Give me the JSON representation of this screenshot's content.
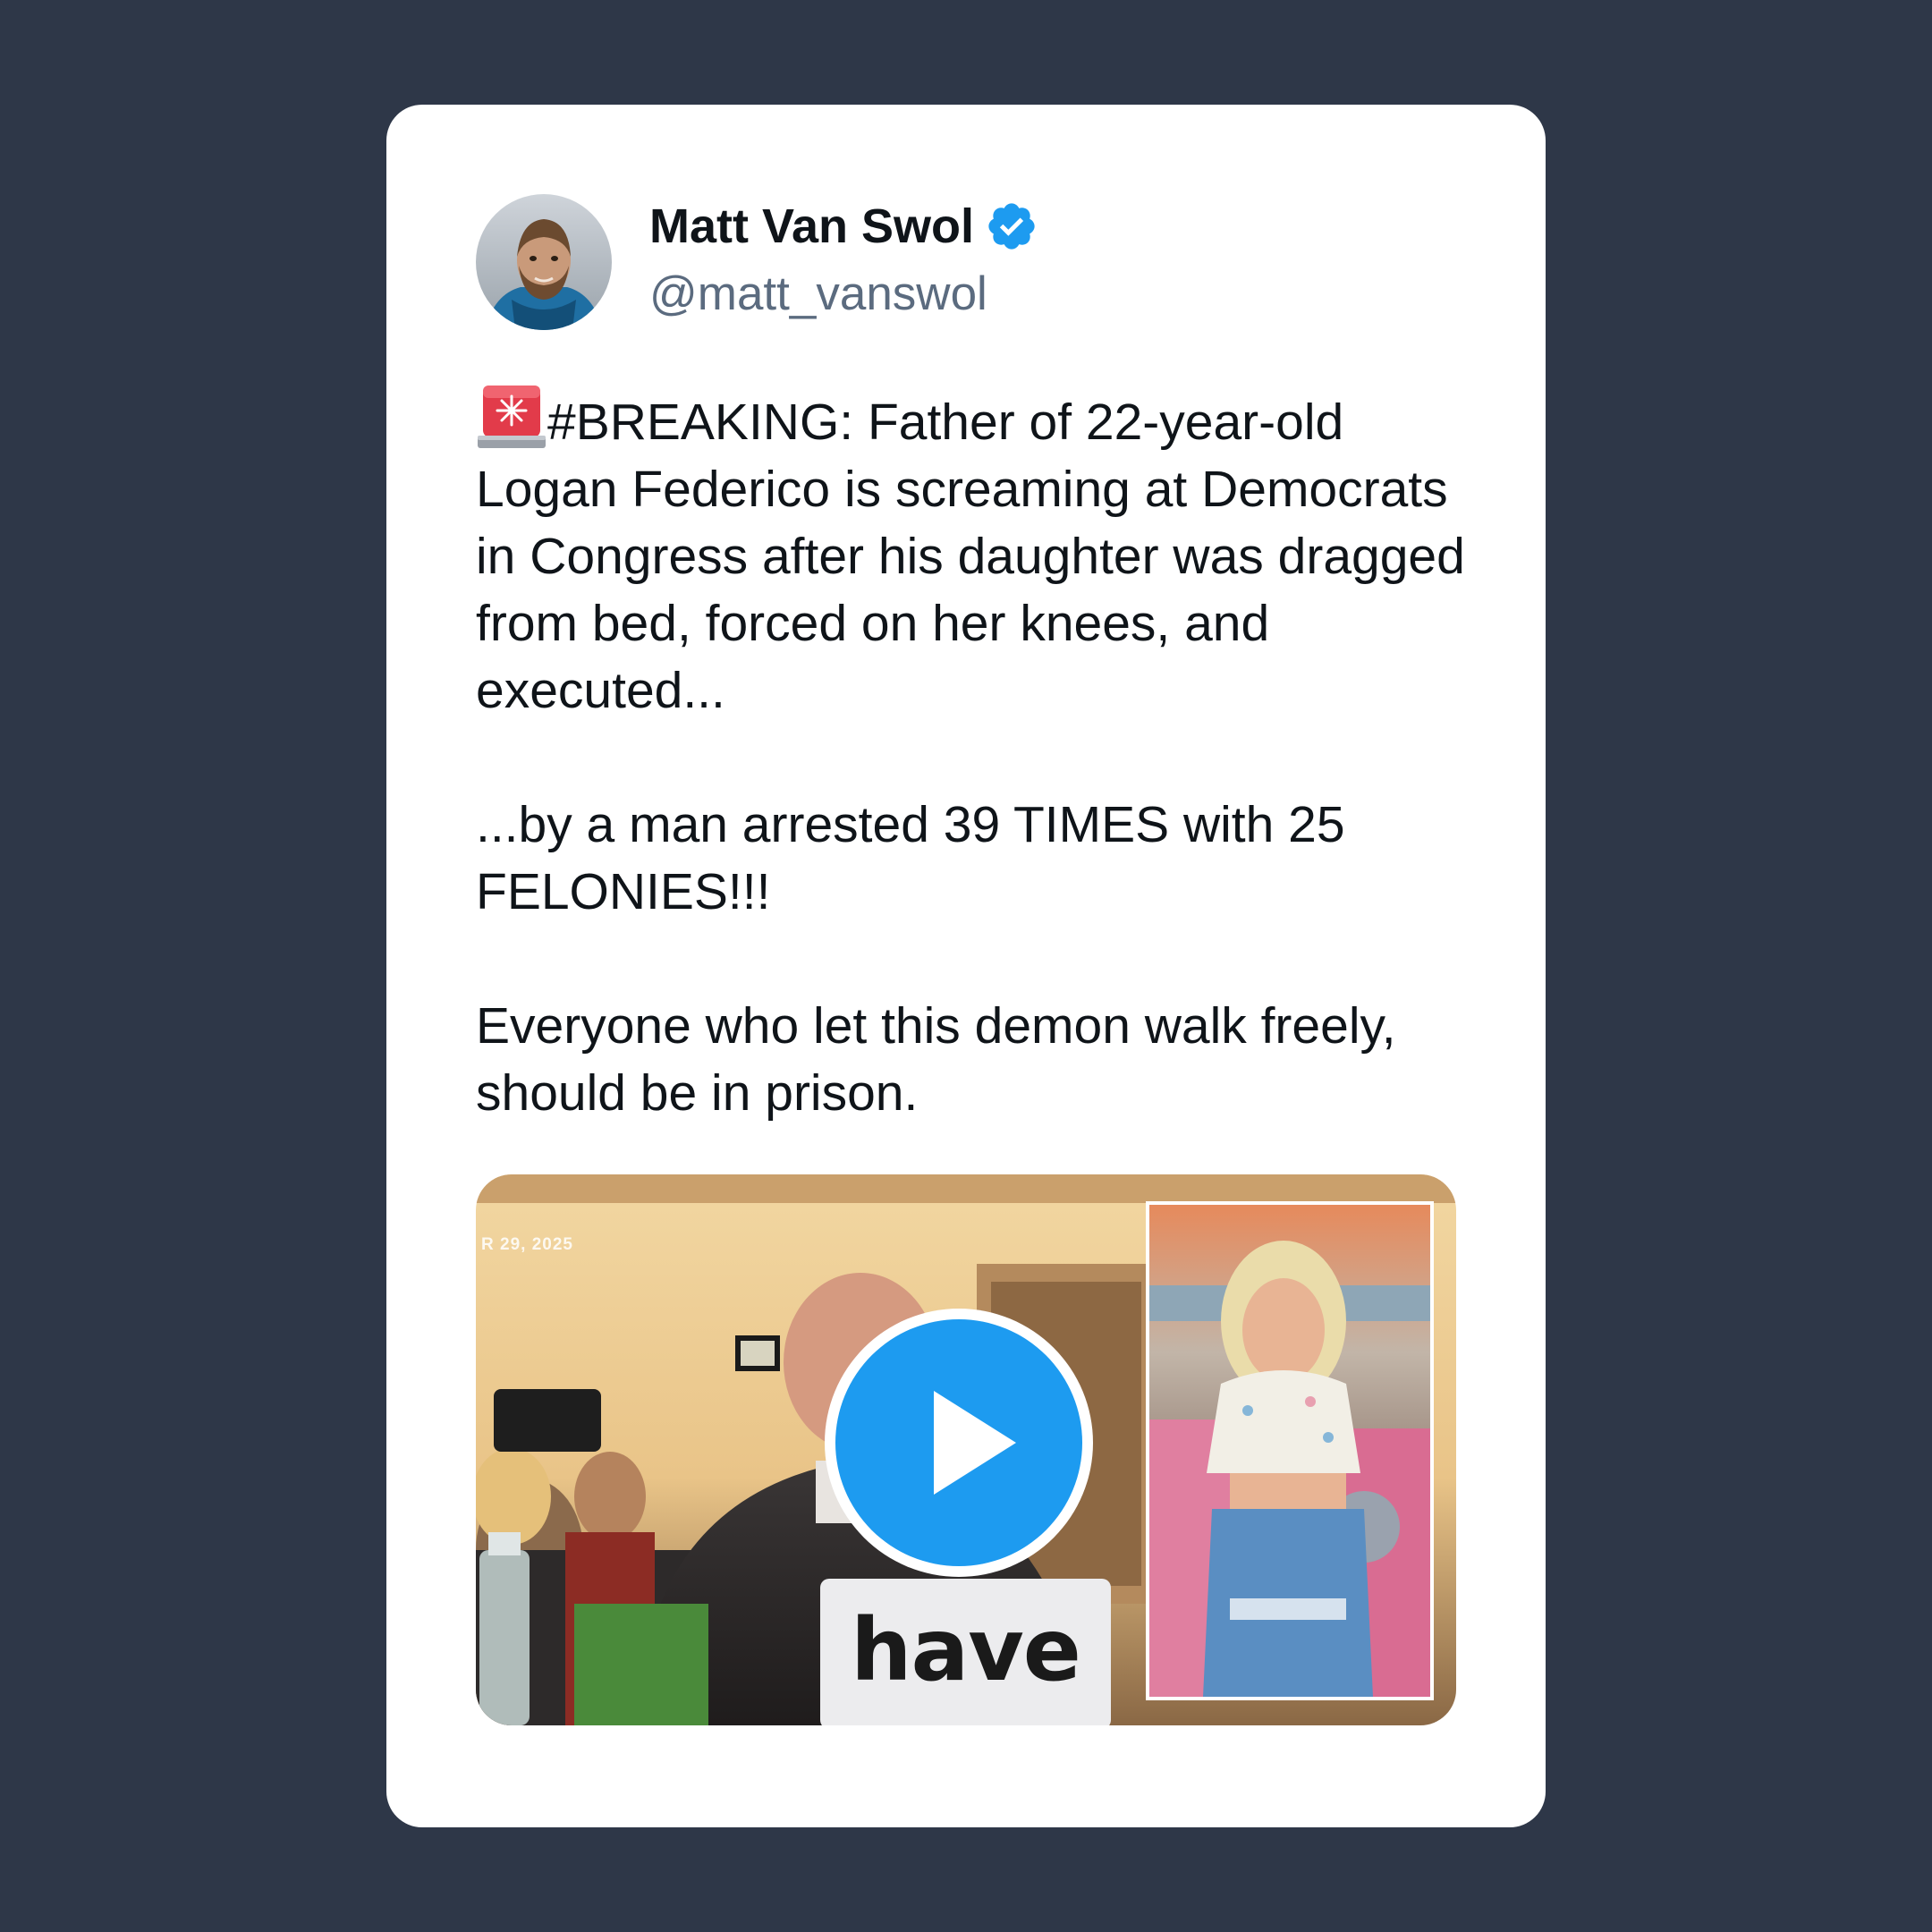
{
  "tweet": {
    "author": {
      "display_name": "Matt Van Swol",
      "handle": "@matt_vanswol",
      "verified": true
    },
    "icons": {
      "siren": "police-car-light-icon",
      "verified": "verified-badge-icon",
      "play": "play-icon"
    },
    "paragraphs": [
      "#BREAKING: Father of 22-year-old Logan Federico is screaming at Democrats in Congress after his daughter was dragged from bed, forced on her knees, and executed...",
      "...by a man arrested 39 TIMES with 25 FELONIES!!!",
      "Everyone who let this demon walk freely, should be in prison."
    ],
    "media": {
      "type": "video",
      "date_stamp": "R 29, 2025",
      "caption": "have"
    }
  },
  "colors": {
    "background": "#2e3748",
    "card": "#ffffff",
    "verified_badge": "#1d9bf0",
    "play_button": "#1d9bf0",
    "handle_text": "#5b6b7f"
  }
}
